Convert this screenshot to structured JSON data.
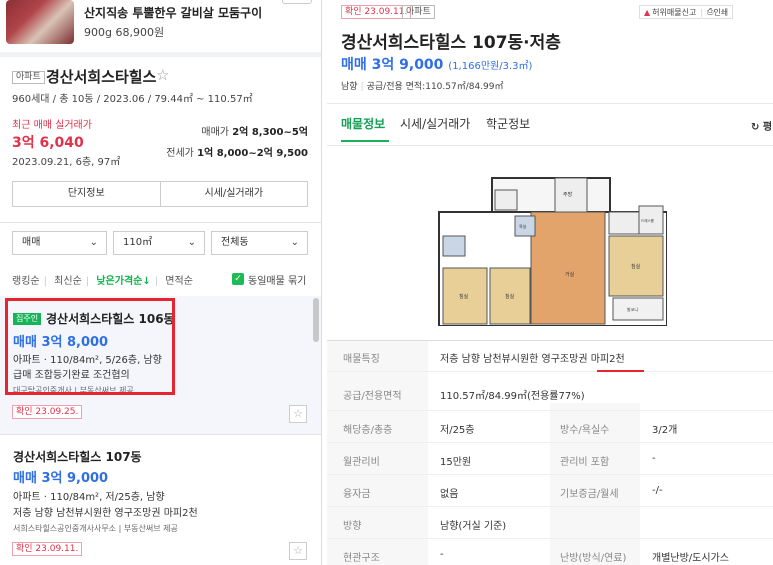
{
  "ad": {
    "title": "산지직송 투뿔한우 갈비살 모둠구이",
    "subtitle": "900g 68,900원"
  },
  "complex": {
    "type_tag": "아파트",
    "name": "경산서희스타힐스",
    "favorite_icon": "star-outline",
    "info": "960세대 / 총 10동 / 2023.06 / 79.44㎡ ~ 110.57㎡",
    "recent_label": "최근 매매 실거래가",
    "recent_price": "3억 6,040",
    "recent_date": "2023.09.21, 6층, 97㎡",
    "deal_label": "매매가",
    "deal_range": "2억 8,300~5억",
    "jeonse_label": "전세가",
    "jeonse_range": "1억 8,000~2억 9,500",
    "buttons": [
      "단지정보",
      "시세/실거래가"
    ]
  },
  "filters": {
    "trade_type": "매매",
    "area": "110㎡",
    "building": "전체동"
  },
  "sort": {
    "options": [
      "랭킹순",
      "최신순",
      "낮은가격순↓",
      "면적순"
    ],
    "active_index": 2,
    "same_listing_label": "동일매물 묶기",
    "same_listing_checked": true
  },
  "listings": [
    {
      "owner_badge": "집주인",
      "title": "경산서희스타힐스 106동",
      "price": "매매 3억 8,000",
      "spec": "아파트 · 110/84m², 5/26층, 남향",
      "desc": "급매 조합등기완료 조건협의",
      "agent": "대구탑공인중개사  |  부동산써브 제공",
      "confirm": "확인 23.09.25."
    },
    {
      "title": "경산서희스타힐스 107동",
      "price": "매매 3억 9,000",
      "spec": "아파트 · 110/84m², 저/25층, 남향",
      "desc": "저층 남향 남천뷰시원한 영구조망권 마피2천",
      "agent": "서희스타힐스공인중개사사무소  |  부동산써브 제공",
      "confirm": "확인 23.09.11."
    }
  ],
  "detail": {
    "confirm": "확인 23.09.11.",
    "type_tag": "아파트",
    "report": "허위매물신고",
    "print": "인쇄",
    "title": "경산서희스타힐스 107동·저층",
    "price": "매매 3억 9,000",
    "price_sub": "(1,166만원/3.3㎡)",
    "direction": "남향",
    "area_meta": "공급/전용 면적:110.57㎡/84.99㎡",
    "tabs": [
      "매물정보",
      "시세/실거래가",
      "학군정보"
    ],
    "active_tab": 0,
    "refresh_label": "평",
    "floorplan_labels": {
      "living": "거실",
      "room1": "침실",
      "room2": "침실",
      "room3": "침실",
      "kitchen": "주방",
      "bath": "욕실",
      "dress": "드레스룸",
      "balcony": "발코니"
    },
    "properties": {
      "feature_label": "매물특징",
      "feature_value": "저층 남향 남천뷰시원한 영구조망권 마피2천",
      "area_label": "공급/전용면적",
      "area_value": "110.57㎡/84.99㎡(전용률77%)",
      "floor_label": "해당층/총층",
      "floor_value": "저/25층",
      "rooms_label": "방수/욕실수",
      "rooms_value": "3/2개",
      "mgmt_label": "월관리비",
      "mgmt_value": "15만원",
      "mgmt_incl_label": "관리비 포함",
      "mgmt_incl_value": "-",
      "loan_label": "융자금",
      "loan_value": "없음",
      "deposit_label": "기보증금/월세",
      "deposit_value": "-/-",
      "dir_label": "방향",
      "dir_value": "남향(거실 기준)",
      "entry_label": "현관구조",
      "entry_value": "-",
      "heat_label": "난방(방식/연료)",
      "heat_value": "개별난방/도시가스"
    }
  },
  "colors": {
    "price_blue": "#2f6fe4",
    "recent_red": "#e2314a",
    "active_green": "#13b44a",
    "highlight_red": "#e8252f"
  }
}
